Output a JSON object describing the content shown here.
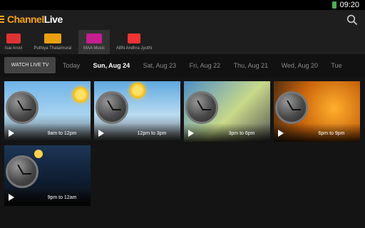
{
  "status": {
    "time": "09:20"
  },
  "app": {
    "logo_a": "Channel",
    "logo_b": "Live"
  },
  "channels": [
    {
      "label": "Isai Aruvi",
      "color": "#d33"
    },
    {
      "label": "Puthiya Thalaimurai",
      "color": "#e8a010"
    },
    {
      "label": "MAA Music",
      "color": "#c51e8e"
    },
    {
      "label": "ABN Andhra Jyothi",
      "color": "#222"
    }
  ],
  "watch_live_label": "WATCH LIVE TV",
  "dates": [
    "Today",
    "Sun, Aug 24",
    "Sat, Aug 23",
    "Fri, Aug 22",
    "Thu, Aug 21",
    "Wed, Aug 20",
    "Tue"
  ],
  "slots": [
    {
      "time": "9am to 12pm"
    },
    {
      "time": "12pm to 3pm"
    },
    {
      "time": "3pm to 6pm"
    },
    {
      "time": "6pm to 9pm"
    },
    {
      "time": "9pm to 12am"
    }
  ]
}
